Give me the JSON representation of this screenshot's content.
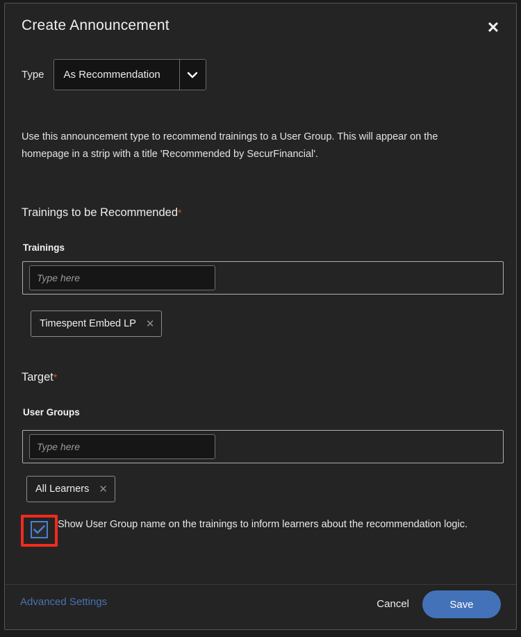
{
  "dialog": {
    "title": "Create Announcement",
    "close_icon": "close-icon"
  },
  "type_row": {
    "label": "Type",
    "selected": "As Recommendation",
    "arrow_icon": "chevron-down-icon"
  },
  "description": "Use this announcement type to recommend trainings to a User Group. This will appear on the homepage in a strip with a title 'Recommended by SecurFinancial'.",
  "trainings_section": {
    "title": "Trainings to be Recommended",
    "required_marker": "*",
    "field_label": "Trainings",
    "input_placeholder": "Type here",
    "input_value": "",
    "chips": [
      {
        "label": "Timespent Embed LP",
        "remove_icon": "close-icon"
      }
    ]
  },
  "target_section": {
    "title": "Target",
    "required_marker": "*",
    "field_label": "User Groups",
    "input_placeholder": "Type here",
    "input_value": "",
    "chips": [
      {
        "label": "All Learners",
        "remove_icon": "close-icon"
      }
    ]
  },
  "checkbox_row": {
    "checked": true,
    "label": "Show User Group name on the trainings to inform learners about the recommendation logic.",
    "check_icon": "check-icon"
  },
  "footer": {
    "advanced_settings": "Advanced Settings",
    "cancel": "Cancel",
    "save": "Save"
  },
  "colors": {
    "accent_blue": "#4372b8",
    "link_blue": "#4a72b0",
    "required_red": "#e5493a",
    "highlight_red": "#f02b1d",
    "modal_bg": "#242424",
    "page_bg": "#1b1b1b"
  }
}
